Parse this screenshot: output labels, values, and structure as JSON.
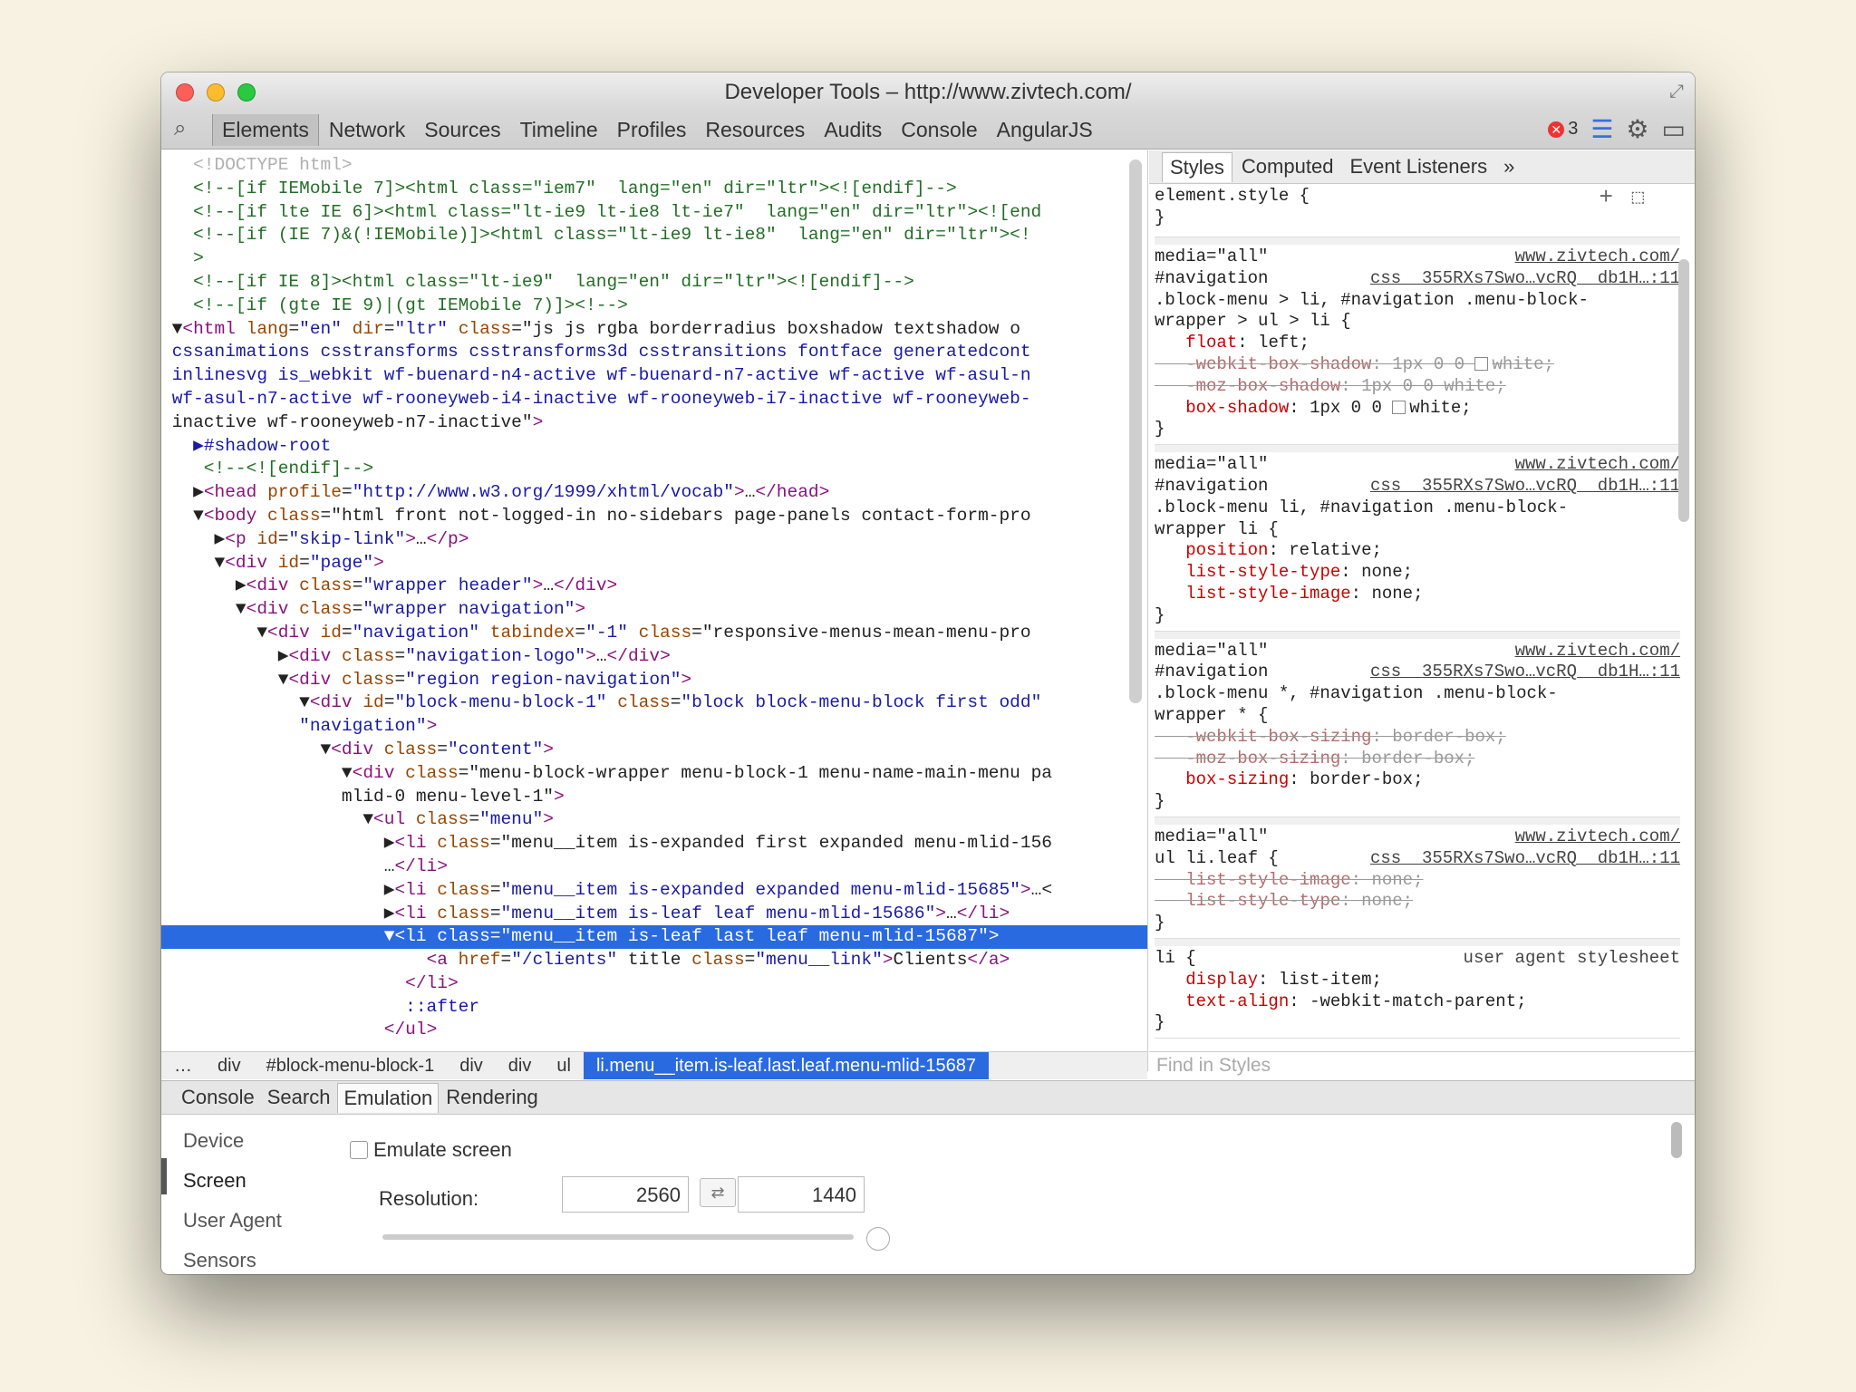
{
  "window": {
    "title": "Developer Tools – http://www.zivtech.com/"
  },
  "toolbar": {
    "tabs": [
      "Elements",
      "Network",
      "Sources",
      "Timeline",
      "Profiles",
      "Resources",
      "Audits",
      "Console",
      "AngularJS"
    ],
    "error_count": "3"
  },
  "dom": {
    "lines": [
      "<!DOCTYPE html>",
      "<!--[if IEMobile 7]><html class=\"iem7\"  lang=\"en\" dir=\"ltr\"><![endif]-->",
      "<!--[if lte IE 6]><html class=\"lt-ie9 lt-ie8 lt-ie7\"  lang=\"en\" dir=\"ltr\"><![end",
      "<!--[if (IE 7)&(!IEMobile)]><html class=\"lt-ie9 lt-ie8\"  lang=\"en\" dir=\"ltr\"><!",
      ">",
      "<!--[if IE 8]><html class=\"lt-ie9\"  lang=\"en\" dir=\"ltr\"><![endif]-->",
      "<!--[if (gte IE 9)|(gt IEMobile 7)]><!-->",
      "▼<html lang=\"en\" dir=\"ltr\" class=\"js js rgba borderradius boxshadow textshadow o",
      "cssanimations csstransforms csstransforms3d csstransitions fontface generatedcont",
      "inlinesvg is_webkit wf-buenard-n4-active wf-buenard-n7-active wf-active wf-asul-n",
      "wf-asul-n7-active wf-rooneyweb-i4-inactive wf-rooneyweb-i7-inactive wf-rooneyweb-",
      "inactive wf-rooneyweb-n7-inactive\">",
      "  ▶#shadow-root",
      "   <!--<![endif]-->",
      "  ▶<head profile=\"http://www.w3.org/1999/xhtml/vocab\">…</head>",
      "  ▼<body class=\"html front not-logged-in no-sidebars page-panels contact-form-pro",
      "    ▶<p id=\"skip-link\">…</p>",
      "    ▼<div id=\"page\">",
      "      ▶<div class=\"wrapper header\">…</div>",
      "      ▼<div class=\"wrapper navigation\">",
      "        ▼<div id=\"navigation\" tabindex=\"-1\" class=\"responsive-menus-mean-menu-pro",
      "          ▶<div class=\"navigation-logo\">…</div>",
      "          ▼<div class=\"region region-navigation\">",
      "            ▼<div id=\"block-menu-block-1\" class=\"block block-menu-block first odd\"",
      "            \"navigation\">",
      "              ▼<div class=\"content\">",
      "                ▼<div class=\"menu-block-wrapper menu-block-1 menu-name-main-menu pa",
      "                mlid-0 menu-level-1\">",
      "                  ▼<ul class=\"menu\">",
      "                    ▶<li class=\"menu__item is-expanded first expanded menu-mlid-156",
      "                    …</li>",
      "                    ▶<li class=\"menu__item is-expanded expanded menu-mlid-15685\">…<",
      "                    ▶<li class=\"menu__item is-leaf leaf menu-mlid-15686\">…</li>",
      "                    ▼<li class=\"menu__item is-leaf last leaf menu-mlid-15687\">",
      "                        <a href=\"/clients\" title class=\"menu__link\">Clients</a>",
      "                      </li>",
      "                      ::after",
      "                    </ul>"
    ],
    "selected_index": 33
  },
  "breadcrumbs": [
    "…",
    "div",
    "#block-menu-block-1",
    "div",
    "div",
    "ul",
    "li.menu__item.is-leaf.last.leaf.menu-mlid-15687"
  ],
  "styles": {
    "tabs": [
      "Styles",
      "Computed",
      "Event Listeners",
      "»"
    ],
    "element_style": [
      "element.style {",
      "}"
    ],
    "rules": [
      {
        "media": "media=\"all\"",
        "source_top": "www.zivtech.com/",
        "selector_lines": [
          "#navigation",
          "css__355RXs7Swo…vcRQ__db1H…:11",
          ".block-menu > li, #navigation .menu-block-",
          "wrapper > ul > li {"
        ],
        "props": [
          {
            "name": "float",
            "value": "left;",
            "struck": false,
            "swatch": false
          },
          {
            "name": "-webkit-box-shadow",
            "value": "1px 0 0 white;",
            "struck": true,
            "swatch": true
          },
          {
            "name": "-moz-box-shadow",
            "value": "1px 0 0 white;",
            "struck": true,
            "swatch": false
          },
          {
            "name": "box-shadow",
            "value": "1px 0 0 white;",
            "struck": false,
            "swatch": true
          }
        ]
      },
      {
        "media": "media=\"all\"",
        "source_top": "www.zivtech.com/",
        "selector_lines": [
          "#navigation",
          "css__355RXs7Swo…vcRQ__db1H…:11",
          ".block-menu li, #navigation .menu-block-",
          "wrapper li {"
        ],
        "props": [
          {
            "name": "position",
            "value": "relative;",
            "struck": false,
            "swatch": false
          },
          {
            "name": "list-style-type",
            "value": "none;",
            "struck": false,
            "swatch": false
          },
          {
            "name": "list-style-image",
            "value": "none;",
            "struck": false,
            "swatch": false
          }
        ]
      },
      {
        "media": "media=\"all\"",
        "source_top": "www.zivtech.com/",
        "selector_lines": [
          "#navigation",
          "css__355RXs7Swo…vcRQ__db1H…:11",
          ".block-menu *, #navigation .menu-block-",
          "wrapper * {"
        ],
        "props": [
          {
            "name": "-webkit-box-sizing",
            "value": "border-box;",
            "struck": true,
            "swatch": false
          },
          {
            "name": "-moz-box-sizing",
            "value": "border-box;",
            "struck": true,
            "swatch": false
          },
          {
            "name": "box-sizing",
            "value": "border-box;",
            "struck": false,
            "swatch": false
          }
        ]
      },
      {
        "media": "media=\"all\"",
        "source_top": "www.zivtech.com/",
        "selector_lines": [
          "ul li.leaf {",
          "css__355RXs7Swo…vcRQ__db1H…:11"
        ],
        "props": [
          {
            "name": "list-style-image",
            "value": "none;",
            "struck": true,
            "swatch": false
          },
          {
            "name": "list-style-type",
            "value": "none;",
            "struck": true,
            "swatch": false
          }
        ]
      }
    ],
    "ua_rule": {
      "selector": "li {",
      "label": "user agent stylesheet",
      "props": [
        {
          "name": "display",
          "value": "list-item;"
        },
        {
          "name": "text-align",
          "value": "-webkit-match-parent;"
        }
      ]
    },
    "find_placeholder": "Find in Styles"
  },
  "drawer": {
    "tabs": [
      "Console",
      "Search",
      "Emulation",
      "Rendering"
    ],
    "active_tab": "Emulation",
    "nav": [
      "Device",
      "Screen",
      "User Agent",
      "Sensors"
    ],
    "emulate_label": "Emulate screen",
    "resolution_label": "Resolution:",
    "width": "2560",
    "height": "1440"
  }
}
